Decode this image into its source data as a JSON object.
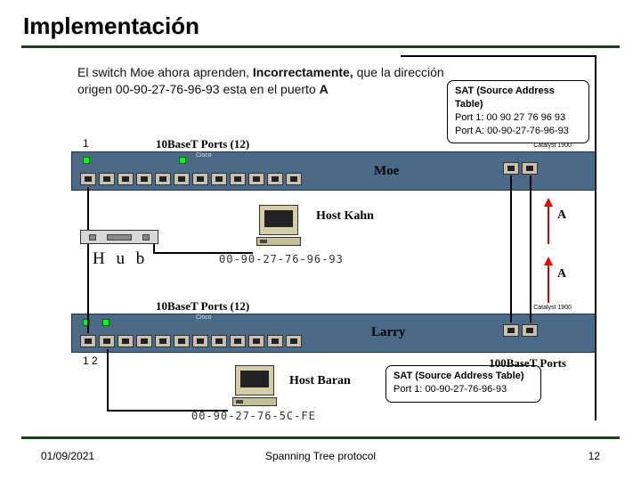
{
  "slide": {
    "title": "Implementación",
    "caption_part1": "El switch Moe ahora aprenden, ",
    "caption_emph": "Incorrectamente, ",
    "caption_part2": "que la dirección origen  00-90-27-76-96-93  esta en el puerto ",
    "caption_port": "A",
    "footer": {
      "date": "01/09/2021",
      "title": "Spanning Tree protocol",
      "page": "12"
    }
  },
  "labels": {
    "ports12": "10BaseT Ports  (12)",
    "ports100": "100BaseT Ports",
    "catalyst": "Catalyst 1900",
    "cisco": "Cisco",
    "moe": "Moe",
    "larry": "Larry",
    "hub": "H u b",
    "port1num": "1",
    "port12num": "1   2",
    "host_kahn": "Host Kahn",
    "host_baran": "Host Baran",
    "mac_kahn": "00-90-27-76-96-93",
    "mac_baran": "00-90-27-76-5C-FE",
    "arrow_a": "A"
  },
  "sat_moe": {
    "title": "SAT (Source Address Table)",
    "row1": "Port 1:  00 90 27 76 96 93",
    "row2": "Port A:  00-90-27-76-96-93"
  },
  "sat_larry": {
    "title": "SAT (Source Address Table)",
    "row1": "Port 1:  00-90-27-76-96-93"
  }
}
